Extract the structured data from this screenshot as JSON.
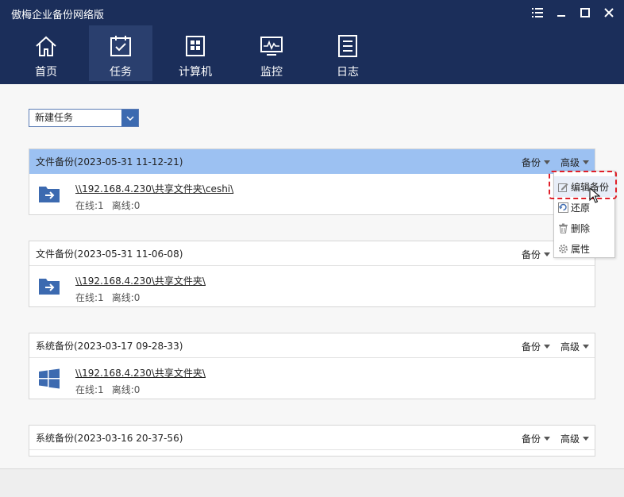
{
  "window": {
    "title": "傲梅企业备份网络版"
  },
  "nav": [
    {
      "label": "首页",
      "icon": "home-icon"
    },
    {
      "label": "任务",
      "icon": "task-calendar-icon",
      "active": true
    },
    {
      "label": "计算机",
      "icon": "computer-icon"
    },
    {
      "label": "监控",
      "icon": "monitor-icon"
    },
    {
      "label": "日志",
      "icon": "log-icon"
    }
  ],
  "toolbar": {
    "new_task_label": "新建任务"
  },
  "tasks": [
    {
      "title": "文件备份(2023-05-31 11-12-21)",
      "backup_label": "备份",
      "advanced_label": "高级",
      "path": "\\\\192.168.4.230\\共享文件夹\\ceshi\\",
      "online": "在线:1",
      "offline": "离线:0",
      "icon": "folder-arrow-icon",
      "selected": true
    },
    {
      "title": "文件备份(2023-05-31 11-06-08)",
      "backup_label": "备份",
      "path": "\\\\192.168.4.230\\共享文件夹\\",
      "online": "在线:1",
      "offline": "离线:0",
      "icon": "folder-arrow-icon"
    },
    {
      "title": "系统备份(2023-03-17 09-28-33)",
      "backup_label": "备份",
      "advanced_label": "高级",
      "path": "\\\\192.168.4.230\\共享文件夹\\",
      "online": "在线:1",
      "offline": "离线:0",
      "icon": "windows-logo-icon"
    },
    {
      "title": "系统备份(2023-03-16 20-37-56)",
      "backup_label": "备份",
      "advanced_label": "高级"
    }
  ],
  "context_menu": {
    "items": [
      {
        "label": "编辑备份",
        "icon": "edit-icon",
        "highlighted": true
      },
      {
        "label": "还原",
        "icon": "restore-icon"
      },
      {
        "label": "删除",
        "icon": "trash-icon"
      },
      {
        "label": "属性",
        "icon": "gear-icon"
      }
    ]
  },
  "colors": {
    "titlebar": "#1b2e5a",
    "nav_active": "#2a3f6e",
    "selected_row": "#9cc1f2",
    "accent": "#3c6ab0",
    "highlight_border": "#e0202a"
  }
}
